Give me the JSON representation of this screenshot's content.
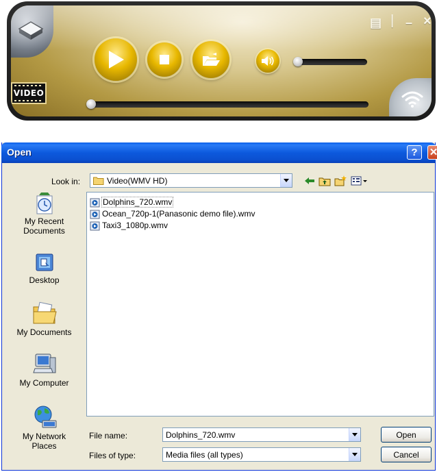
{
  "player": {
    "controls": {
      "play": "play",
      "stop": "stop",
      "open": "open-folder",
      "volume": "speaker"
    },
    "volume_level": 0.03,
    "seek_position": 0.0,
    "badge_text": "VIDEO",
    "window_buttons": {
      "playlist": "▤",
      "minimize": "–",
      "close": "×"
    },
    "colors": {
      "accent": "#e8b800",
      "body": "#d9c991"
    }
  },
  "dialog": {
    "title": "Open",
    "title_buttons": {
      "help": "?",
      "close": "✕"
    },
    "look_in_label": "Look in:",
    "look_in_value": "Video(WMV HD)",
    "toolbar_icons": [
      "back-icon",
      "up-folder-icon",
      "new-folder-icon",
      "views-menu-icon"
    ],
    "places": [
      {
        "label": "My Recent\nDocuments",
        "icon": "recent-documents-icon"
      },
      {
        "label": "Desktop",
        "icon": "desktop-icon"
      },
      {
        "label": "My Documents",
        "icon": "my-documents-icon"
      },
      {
        "label": "My Computer",
        "icon": "my-computer-icon"
      },
      {
        "label": "My Network\nPlaces",
        "icon": "network-places-icon"
      }
    ],
    "files": [
      {
        "name": "Dolphins_720.wmv"
      },
      {
        "name": "Ocean_720p-1(Panasonic demo file).wmv"
      },
      {
        "name": "Taxi3_1080p.wmv"
      }
    ],
    "file_name_label": "File name:",
    "file_name_value": "Dolphins_720.wmv",
    "file_type_label": "Files of type:",
    "file_type_value": "Media files (all types)",
    "open_button": "Open",
    "cancel_button": "Cancel"
  }
}
